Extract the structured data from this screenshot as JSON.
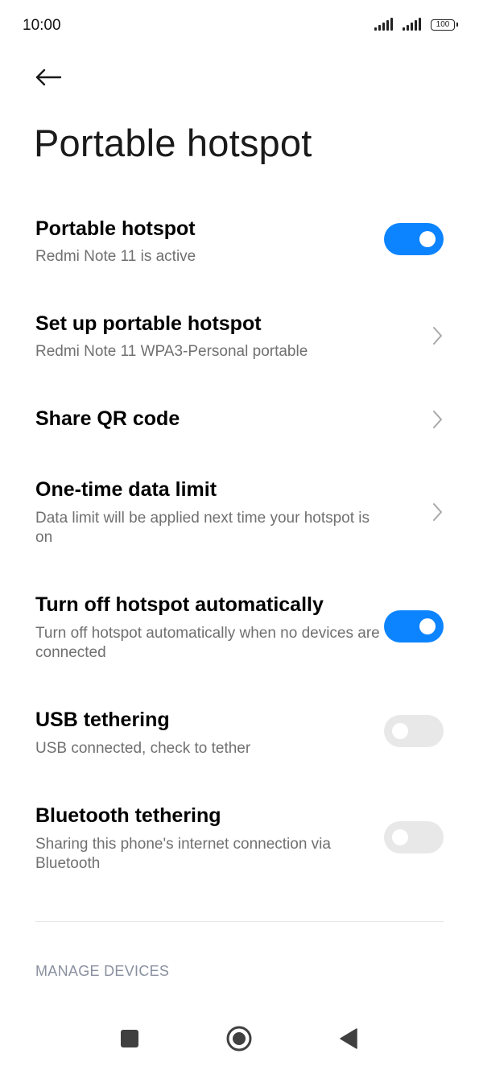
{
  "status_bar": {
    "time": "10:00",
    "battery": "100"
  },
  "header": {
    "back_icon": "arrow-left-icon",
    "title": "Portable hotspot"
  },
  "settings": [
    {
      "title": "Portable hotspot",
      "subtitle": "Redmi Note 11 is active",
      "control": "toggle",
      "checked": true
    },
    {
      "title": "Set up portable hotspot",
      "subtitle": "Redmi Note 11 WPA3-Personal portable",
      "control": "chevron-right-icon"
    },
    {
      "title": "Share QR code",
      "control": "chevron-right-icon"
    },
    {
      "title": "One-time data limit",
      "subtitle": "Data limit will be applied next time your hotspot is on",
      "control": "chevron-right-icon"
    },
    {
      "title": "Turn off hotspot automatically",
      "subtitle": "Turn off hotspot automatically when no devices are connected",
      "control": "toggle",
      "checked": true
    },
    {
      "title": "USB tethering",
      "subtitle": "USB connected, check to tether",
      "control": "toggle",
      "checked": false
    },
    {
      "title": "Bluetooth tethering",
      "subtitle": "Sharing this phone's internet connection via Bluetooth",
      "control": "toggle",
      "checked": false
    }
  ],
  "section_header": "MANAGE DEVICES",
  "navbar": {
    "recents_icon": "square-icon",
    "home_icon": "circle-home-icon",
    "back_icon": "triangle-back-icon"
  },
  "colors": {
    "accent": "#0d84ff",
    "toggle_off": "#e8e8e8",
    "subtitle": "#707070",
    "section_header": "#8a90a0"
  }
}
